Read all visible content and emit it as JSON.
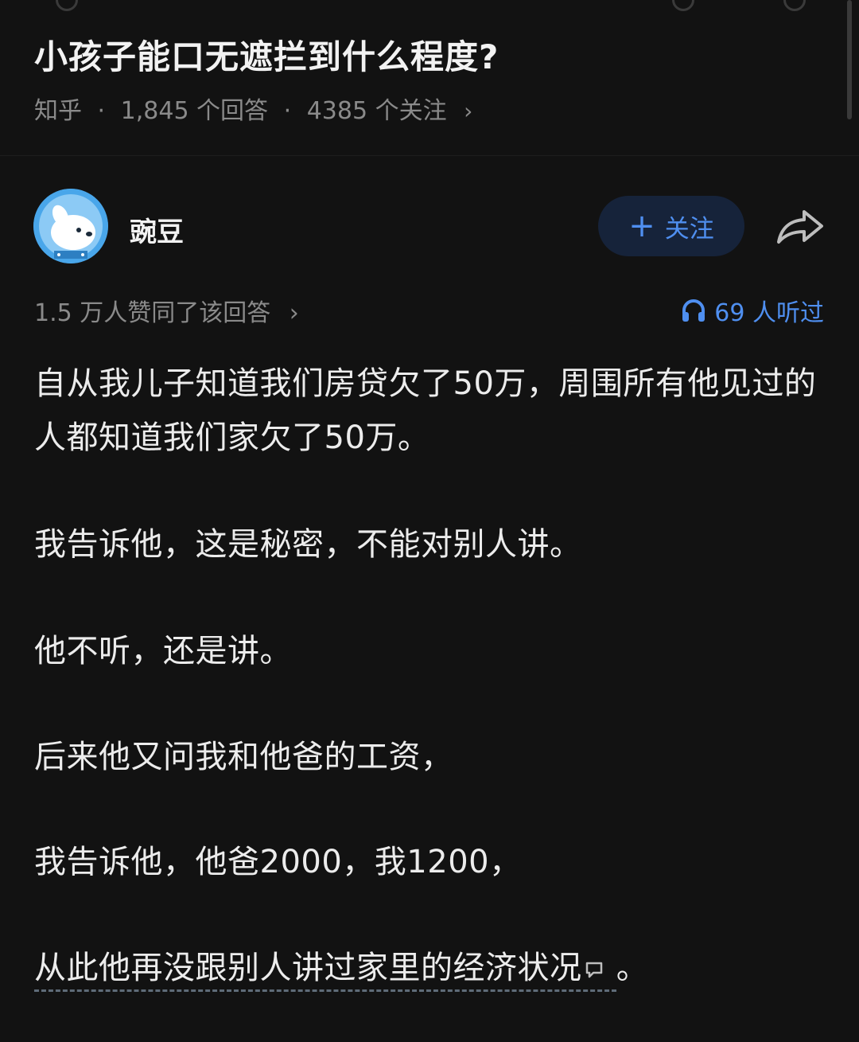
{
  "question": {
    "title": "小孩子能口无遮拦到什么程度?",
    "source": "知乎",
    "answers": "1,845 个回答",
    "followers": "4385 个关注",
    "separator": "·",
    "chevron": "›"
  },
  "author": {
    "name": "豌豆",
    "follow_label": "关注",
    "follow_icon": "plus-icon",
    "share_icon": "share-icon"
  },
  "stats": {
    "likes": "1.5 万人赞同了该回答",
    "chevron": "›",
    "listen_count": "69 人听过",
    "listen_icon": "headphones-icon",
    "accent_color": "#4f8ff0"
  },
  "content": {
    "paragraphs": [
      "自从我儿子知道我们房贷欠了50万，周围所有他见过的人都知道我们家欠了50万。",
      "我告诉他，这是秘密，不能对别人讲。",
      "他不听，还是讲。",
      "后来他又问我和他爸的工资，",
      "我告诉他，他爸2000，我1200，"
    ],
    "last_line": "从此他再没跟别人讲过家里的经济状况",
    "last_punct": "。",
    "comment_icon": "comment-icon"
  }
}
